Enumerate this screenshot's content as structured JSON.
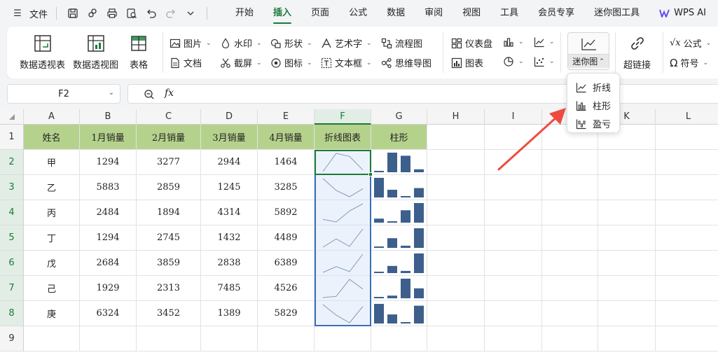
{
  "menubar": {
    "file_label": "文件",
    "tabs": [
      "开始",
      "插入",
      "页面",
      "公式",
      "数据",
      "审阅",
      "视图",
      "工具",
      "会员专享",
      "迷你图工具",
      "WPS AI"
    ],
    "active_tab": "插入",
    "accent": "#1a7a3a"
  },
  "ribbon": {
    "pivot_table": "数据透视表",
    "pivot_chart": "数据透视图",
    "table": "表格",
    "picture": "图片",
    "watermark": "水印",
    "shape": "形状",
    "wordart": "艺术字",
    "flowchart": "流程图",
    "document": "文档",
    "screenshot": "截屏",
    "icon": "图标",
    "textbox": "文本框",
    "mindmap": "思维导图",
    "dashboard": "仪表盘",
    "chart": "图表",
    "sparkline": "迷你图",
    "hyperlink": "超链接",
    "formula": "公式",
    "symbol": "符号"
  },
  "formula_bar": {
    "cell_ref": "F2",
    "fx": "fx"
  },
  "sparkline_menu": {
    "items": [
      "折线",
      "柱形",
      "盈亏"
    ]
  },
  "sheet": {
    "columns": [
      "A",
      "B",
      "C",
      "D",
      "E",
      "F",
      "G",
      "H",
      "I",
      "J",
      "K",
      "L"
    ],
    "rows": [
      "1",
      "2",
      "3",
      "4",
      "5",
      "6",
      "7",
      "8",
      "9"
    ],
    "headers": [
      "姓名",
      "1月销量",
      "2月销量",
      "3月销量",
      "4月销量",
      "折线图表",
      "柱形"
    ],
    "data": [
      [
        "甲",
        "1294",
        "3277",
        "2944",
        "1464"
      ],
      [
        "乙",
        "5883",
        "2859",
        "1245",
        "3285"
      ],
      [
        "丙",
        "2484",
        "1894",
        "4314",
        "5892"
      ],
      [
        "丁",
        "1294",
        "2745",
        "1432",
        "4489"
      ],
      [
        "戊",
        "2684",
        "3859",
        "2838",
        "6389"
      ],
      [
        "己",
        "1929",
        "2313",
        "7485",
        "4526"
      ],
      [
        "庚",
        "6324",
        "3452",
        "1389",
        "5829"
      ]
    ],
    "header_fill": "#b5d28c",
    "spark_color": "#3c5f8c"
  }
}
